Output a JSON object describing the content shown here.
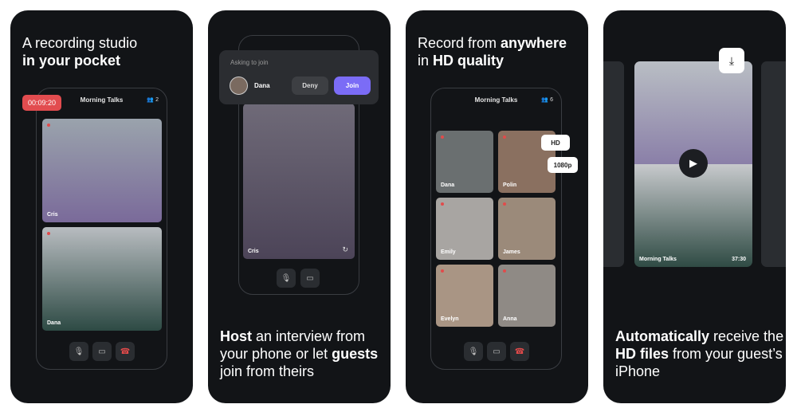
{
  "colors": {
    "background": "#121417",
    "accent": "#7b6cf6",
    "record": "#e24c4f"
  },
  "card1": {
    "headline_light": "A recording studio",
    "headline_bold": "in your pocket",
    "timer": "00:09:20",
    "title": "Morning Talks",
    "participants": "2",
    "tiles": [
      {
        "name": "Cris"
      },
      {
        "name": "Dana"
      }
    ],
    "controls": [
      "mic-icon",
      "camera-icon",
      "end-call-icon"
    ]
  },
  "card2": {
    "popup": {
      "label": "Asking to join",
      "name": "Dana",
      "deny": "Deny",
      "join": "Join"
    },
    "tile": {
      "name": "Cris"
    },
    "controls": [
      "mic-icon",
      "camera-icon"
    ],
    "text": {
      "b1": "Host",
      "t1": " an interview from your phone or let ",
      "b2": "guests",
      "t2": " join from theirs"
    }
  },
  "card3": {
    "headline_light1": "Record from ",
    "headline_bold1": "anywhere",
    "headline_light2": "in ",
    "headline_bold2": "HD quality",
    "title": "Morning Talks",
    "participants": "6",
    "chips": [
      "HD",
      "1080p"
    ],
    "tiles": [
      {
        "name": "Dana"
      },
      {
        "name": "Polin"
      },
      {
        "name": "Emily"
      },
      {
        "name": "James"
      },
      {
        "name": "Evelyn"
      },
      {
        "name": "Anna"
      }
    ]
  },
  "card4": {
    "video_title": "Morning Talks",
    "duration": "37:30",
    "text": {
      "b1": "Automatically",
      "t1": " receive the ",
      "b2": "HD files",
      "t2": " from your guest’s iPhone"
    }
  }
}
